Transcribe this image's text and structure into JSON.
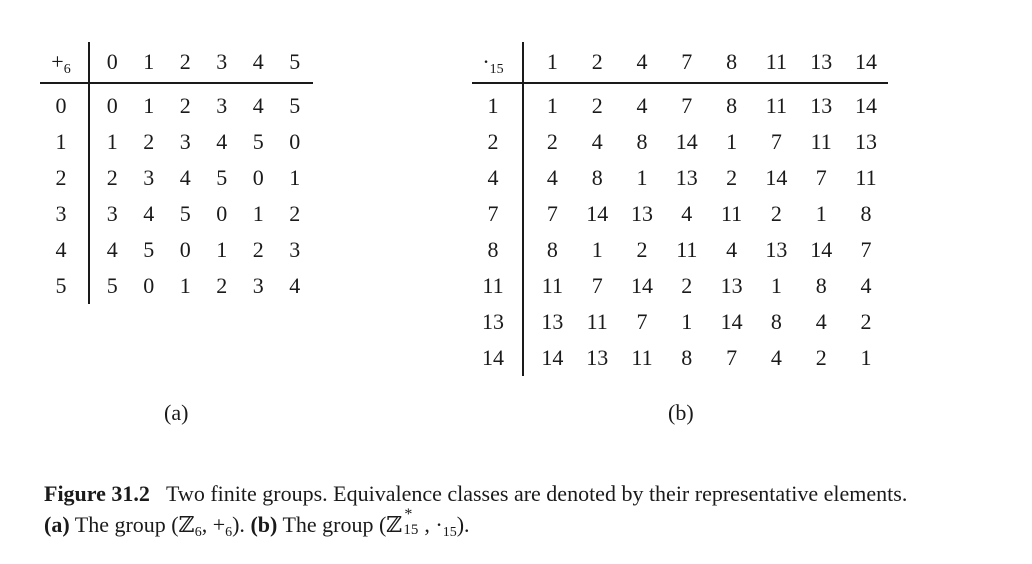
{
  "table_a": {
    "operator": "+",
    "operator_sub": "6",
    "header": [
      "0",
      "1",
      "2",
      "3",
      "4",
      "5"
    ],
    "rows": [
      {
        "label": "0",
        "cells": [
          "0",
          "1",
          "2",
          "3",
          "4",
          "5"
        ]
      },
      {
        "label": "1",
        "cells": [
          "1",
          "2",
          "3",
          "4",
          "5",
          "0"
        ]
      },
      {
        "label": "2",
        "cells": [
          "2",
          "3",
          "4",
          "5",
          "0",
          "1"
        ]
      },
      {
        "label": "3",
        "cells": [
          "3",
          "4",
          "5",
          "0",
          "1",
          "2"
        ]
      },
      {
        "label": "4",
        "cells": [
          "4",
          "5",
          "0",
          "1",
          "2",
          "3"
        ]
      },
      {
        "label": "5",
        "cells": [
          "5",
          "0",
          "1",
          "2",
          "3",
          "4"
        ]
      }
    ],
    "panel_label": "(a)"
  },
  "table_b": {
    "operator": "·",
    "operator_sub": "15",
    "header": [
      "1",
      "2",
      "4",
      "7",
      "8",
      "11",
      "13",
      "14"
    ],
    "rows": [
      {
        "label": "1",
        "cells": [
          "1",
          "2",
          "4",
          "7",
          "8",
          "11",
          "13",
          "14"
        ]
      },
      {
        "label": "2",
        "cells": [
          "2",
          "4",
          "8",
          "14",
          "1",
          "7",
          "11",
          "13"
        ]
      },
      {
        "label": "4",
        "cells": [
          "4",
          "8",
          "1",
          "13",
          "2",
          "14",
          "7",
          "11"
        ]
      },
      {
        "label": "7",
        "cells": [
          "7",
          "14",
          "13",
          "4",
          "11",
          "2",
          "1",
          "8"
        ]
      },
      {
        "label": "8",
        "cells": [
          "8",
          "1",
          "2",
          "11",
          "4",
          "13",
          "14",
          "7"
        ]
      },
      {
        "label": "11",
        "cells": [
          "11",
          "7",
          "14",
          "2",
          "13",
          "1",
          "8",
          "4"
        ]
      },
      {
        "label": "13",
        "cells": [
          "13",
          "11",
          "7",
          "1",
          "14",
          "8",
          "4",
          "2"
        ]
      },
      {
        "label": "14",
        "cells": [
          "14",
          "13",
          "11",
          "8",
          "7",
          "4",
          "2",
          "1"
        ]
      }
    ],
    "panel_label": "(b)"
  },
  "caption": {
    "figure_label": "Figure 31.2",
    "text": "Two finite groups. Equivalence classes are denoted by their representative elements.",
    "part_a_label": "(a)",
    "part_a_text_prefix": "The group (",
    "part_a_math": "ℤ",
    "part_a_math_sub": "6",
    "part_a_math_rest": ", +",
    "part_a_math_rest_sub": "6",
    "part_a_text_suffix": ").",
    "part_b_label": "(b)",
    "part_b_text_prefix": "The group (",
    "part_b_math": "ℤ",
    "part_b_math_sup": "*",
    "part_b_math_sub": "15",
    "part_b_math_rest": ", ·",
    "part_b_math_rest_sub": "15",
    "part_b_text_suffix": ")."
  }
}
